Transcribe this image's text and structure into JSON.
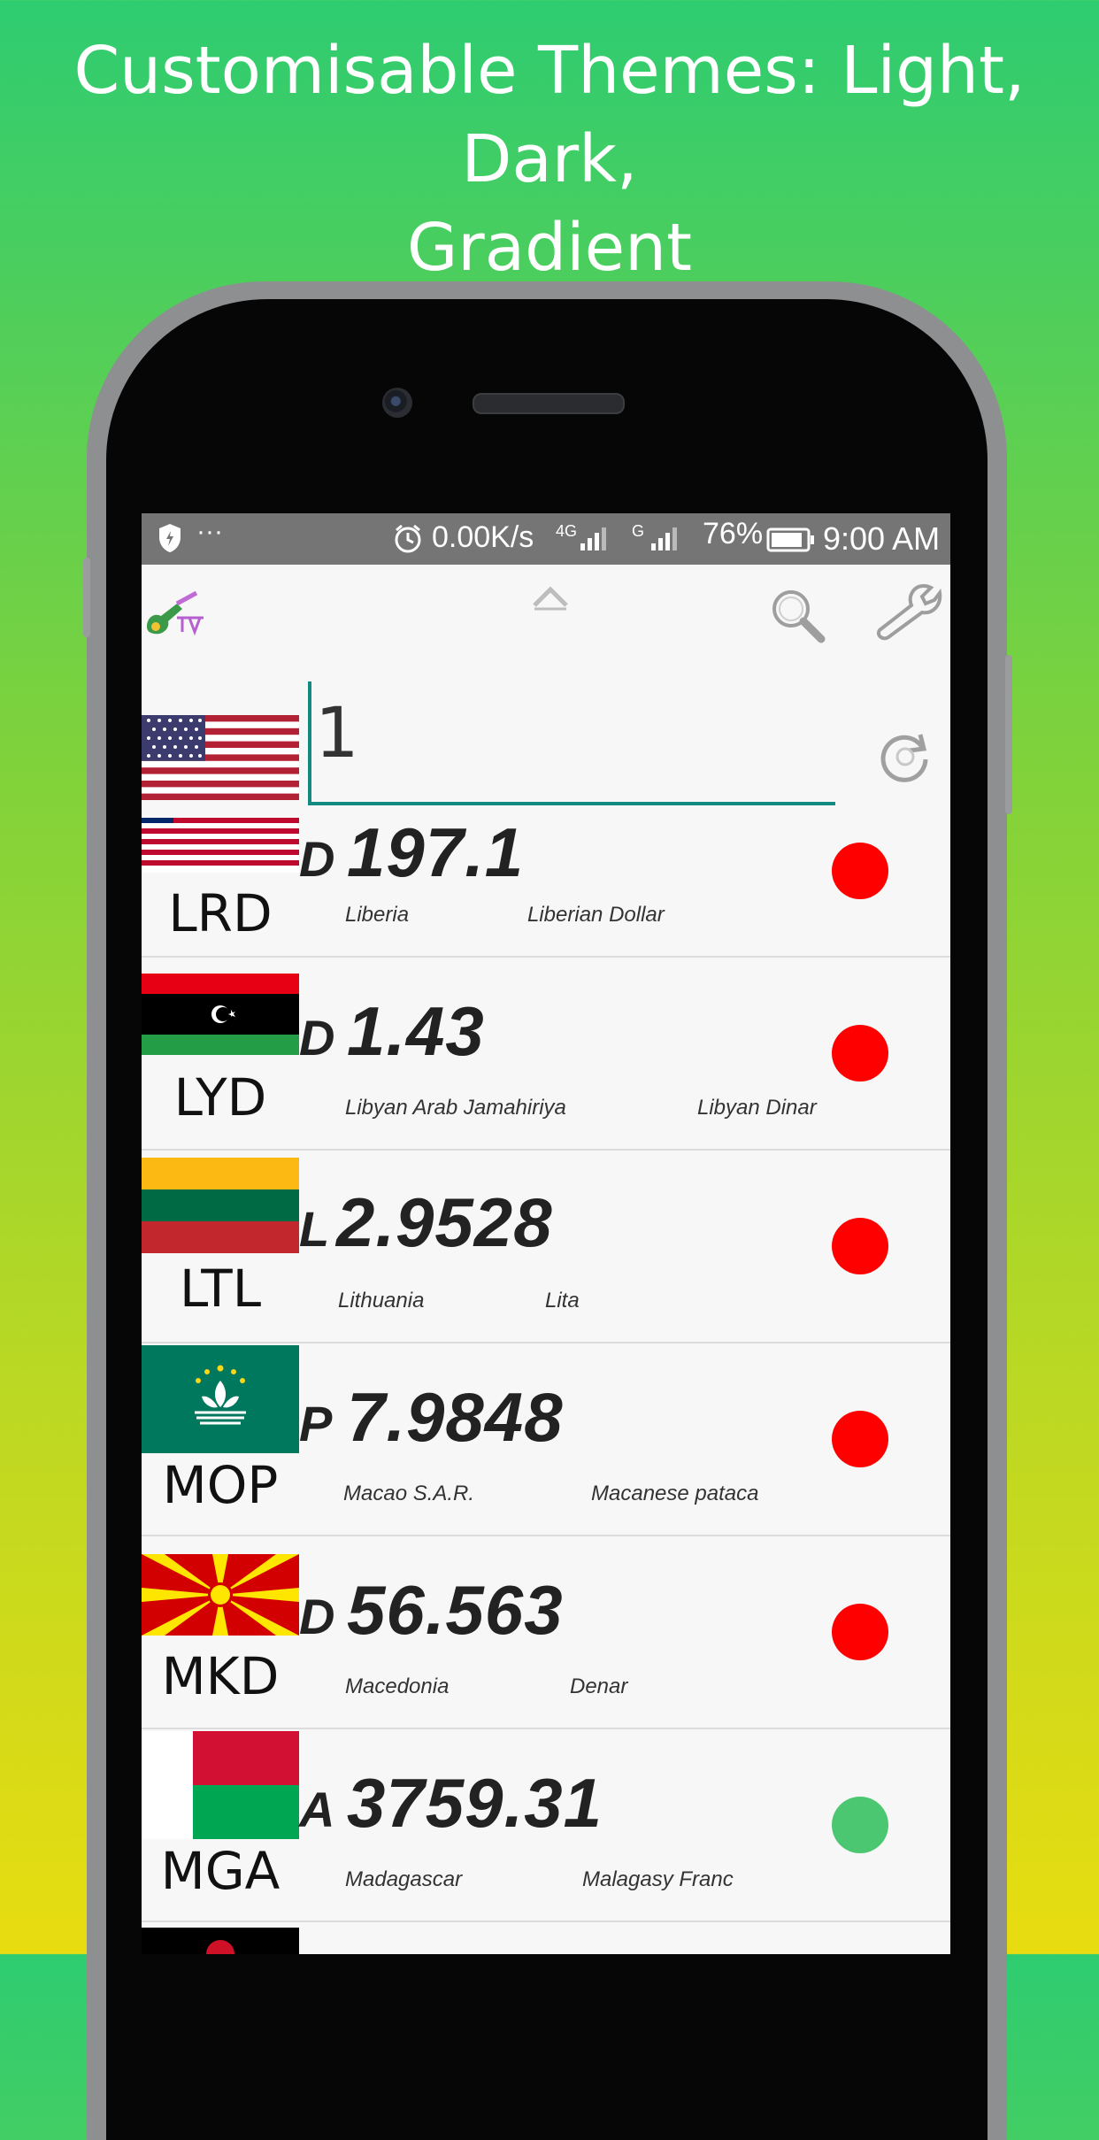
{
  "headline": {
    "line1": "Customisable Themes: Light, Dark,",
    "line2": "Gradient"
  },
  "status_bar": {
    "more": "···",
    "speed": "0.00K/s",
    "network1": "4G",
    "network2": "G",
    "battery": "76%",
    "time": "9:00 AM",
    "icons": [
      "shield-icon",
      "alarm-icon",
      "signal-icon",
      "battery-icon"
    ]
  },
  "app_bar": {
    "icons": [
      "app-logo-icon",
      "chevron-up-icon",
      "search-icon",
      "wrench-icon"
    ]
  },
  "input": {
    "value": "1",
    "base_flag": "us-flag"
  },
  "colors": {
    "accent": "#138a80",
    "status_red": "#ff0000",
    "status_green": "#4cc771",
    "statusbar": "#757575"
  },
  "currencies": [
    {
      "code": "LRD",
      "symbol": "D",
      "value": "197.1",
      "country": "Liberia",
      "currency": "Liberian Dollar",
      "status_color": "#ff0000",
      "flag": "liberia-flag"
    },
    {
      "code": "LYD",
      "symbol": "D",
      "value": "1.43",
      "country": "Libyan Arab Jamahiriya",
      "currency": "Libyan Dinar",
      "status_color": "#ff0000",
      "flag": "libya-flag"
    },
    {
      "code": "LTL",
      "symbol": "L",
      "value": "2.9528",
      "country": "Lithuania",
      "currency": "Lita",
      "status_color": "#ff0000",
      "flag": "lithuania-flag"
    },
    {
      "code": "MOP",
      "symbol": "P",
      "value": "7.9848",
      "country": "Macao S.A.R.",
      "currency": "Macanese pataca",
      "status_color": "#ff0000",
      "flag": "macao-flag"
    },
    {
      "code": "MKD",
      "symbol": "D",
      "value": "56.563",
      "country": "Macedonia",
      "currency": "Denar",
      "status_color": "#ff0000",
      "flag": "macedonia-flag"
    },
    {
      "code": "MGA",
      "symbol": "A",
      "value": "3759.31",
      "country": "Madagascar",
      "currency": "Malagasy Franc",
      "status_color": "#4cc771",
      "flag": "madagascar-flag"
    }
  ]
}
